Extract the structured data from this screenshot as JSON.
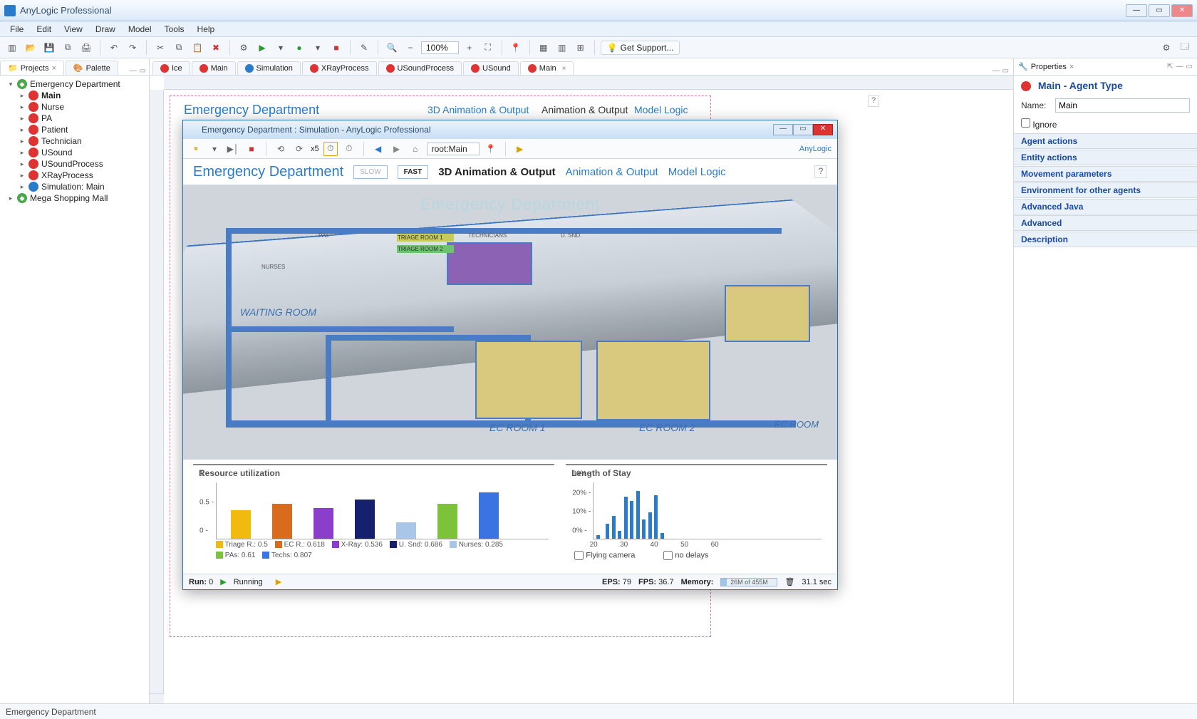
{
  "window": {
    "title": "AnyLogic Professional"
  },
  "menu": [
    "File",
    "Edit",
    "View",
    "Draw",
    "Model",
    "Tools",
    "Help"
  ],
  "toolbar": {
    "zoom": "100%",
    "get_support": "Get Support..."
  },
  "left": {
    "tabs": {
      "projects": "Projects",
      "palette": "Palette"
    },
    "tree": {
      "root1": "Emergency Department",
      "children1": [
        "Main",
        "Nurse",
        "PA",
        "Patient",
        "Technician",
        "USound",
        "USoundProcess",
        "XRayProcess",
        "Simulation: Main"
      ],
      "root2": "Mega Shopping Mall"
    }
  },
  "editor_tabs": [
    "Ice",
    "Main",
    "Simulation",
    "XRayProcess",
    "USoundProcess",
    "USound",
    "Main"
  ],
  "canvas": {
    "title": "Emergency Department",
    "views": {
      "a": "3D Animation & Output",
      "b": "Animation & Output",
      "c": "Model Logic"
    },
    "slow": "SLOW",
    "fast": "FAST",
    "mini_labels": {
      "triage": "TRIAGE ROOM 1",
      "tech": "TECHNICIANS",
      "usnd": "U. SND."
    }
  },
  "properties": {
    "tab": "Properties",
    "title": "Main - Agent Type",
    "name_label": "Name:",
    "name_value": "Main",
    "ignore": "Ignore",
    "sections": [
      "Agent actions",
      "Entity actions",
      "Movement parameters",
      "Environment for other agents",
      "Advanced Java",
      "Advanced",
      "Description"
    ]
  },
  "sim": {
    "title": "Emergency Department : Simulation - AnyLogic Professional",
    "speed": "x5",
    "root_select": "root:Main",
    "brand": "AnyLogic",
    "header": {
      "title": "Emergency Department",
      "slow": "SLOW",
      "fast": "FAST",
      "tab_a": "3D Animation & Output",
      "tab_b": "Animation & Output",
      "tab_c": "Model Logic"
    },
    "watermark": "Emergency Department",
    "rooms": {
      "wait": "WAITING ROOM",
      "ec1": "EC ROOM 1",
      "ec2": "EC ROOM 2",
      "ec3": "EC ROOM",
      "triage1": "TRIAGE ROOM 1",
      "triage2": "TRIAGE ROOM 2",
      "tech": "TECHNICIANS",
      "usnd": "U. SND.",
      "pas": "PAs",
      "nurses": "NURSES"
    },
    "checks": {
      "flying": "Flying camera",
      "nodelays": "no delays"
    },
    "status": {
      "run_label": "Run:",
      "run_val": "0",
      "state": "Running",
      "eps_label": "EPS:",
      "eps": "79",
      "fps_label": "FPS:",
      "fps": "36.7",
      "mem_label": "Memory:",
      "mem_text": "26M of 455M",
      "time": "31.1 sec"
    }
  },
  "status_bar": "Emergency Department",
  "chart_data": [
    {
      "type": "bar",
      "title": "Resource utilization",
      "ylim": [
        0,
        1
      ],
      "yticks": [
        0,
        0.5,
        1
      ],
      "series": [
        {
          "name": "Triage R.",
          "value": 0.5,
          "color": "#f2b90f"
        },
        {
          "name": "EC R.",
          "value": 0.618,
          "color": "#d96b1f"
        },
        {
          "name": "X-Ray",
          "value": 0.536,
          "color": "#8a3ec9"
        },
        {
          "name": "U. Snd",
          "value": 0.686,
          "color": "#16206e"
        },
        {
          "name": "Nurses",
          "value": 0.285,
          "color": "#a9c6e6"
        },
        {
          "name": "PAs",
          "value": 0.61,
          "color": "#7cc23a"
        },
        {
          "name": "Techs",
          "value": 0.807,
          "color": "#3a74e0"
        }
      ]
    },
    {
      "type": "bar",
      "title": "Length of Stay",
      "xlabel": "",
      "ylabel": "",
      "ylim": [
        0,
        30
      ],
      "y_unit": "%",
      "yticks": [
        0,
        10,
        20,
        30
      ],
      "xticks": [
        20,
        30,
        40,
        50,
        60
      ],
      "x": [
        21,
        24,
        26,
        28,
        30,
        32,
        34,
        36,
        38,
        40,
        42
      ],
      "values": [
        2,
        8,
        12,
        4,
        22,
        20,
        25,
        10,
        14,
        23,
        3
      ],
      "color": "#2a7ccb"
    }
  ]
}
